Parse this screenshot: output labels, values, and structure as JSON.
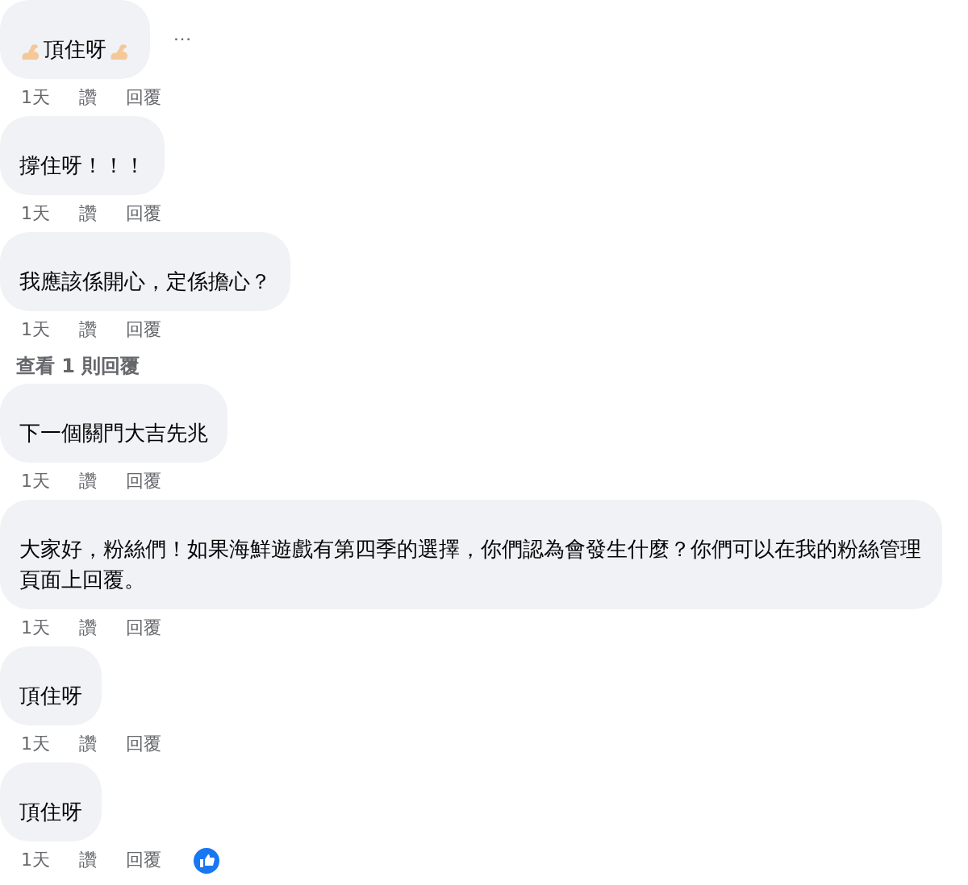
{
  "comments": [
    {
      "text": "頂住呀",
      "arm_emoji": true,
      "more": "…",
      "time": "1天",
      "like": "讚",
      "reply": "回覆"
    },
    {
      "text": "撐住呀！！！",
      "time": "1天",
      "like": "讚",
      "reply": "回覆"
    },
    {
      "text": "我應該係開心，定係擔心？",
      "time": "1天",
      "like": "讚",
      "reply": "回覆",
      "replies_link": "查看 1 則回覆"
    },
    {
      "text": "下一個關門大吉先兆",
      "time": "1天",
      "like": "讚",
      "reply": "回覆"
    },
    {
      "text": "大家好，粉絲們！如果海鮮遊戲有第四季的選擇，你們認為會發生什麼？你們可以在我的粉絲管理頁面上回覆。",
      "time": "1天",
      "like": "讚",
      "reply": "回覆"
    },
    {
      "text": "頂住呀",
      "time": "1天",
      "like": "讚",
      "reply": "回覆"
    },
    {
      "text": "頂住呀",
      "time": "1天",
      "like": "讚",
      "reply": "回覆",
      "liked": true
    }
  ]
}
